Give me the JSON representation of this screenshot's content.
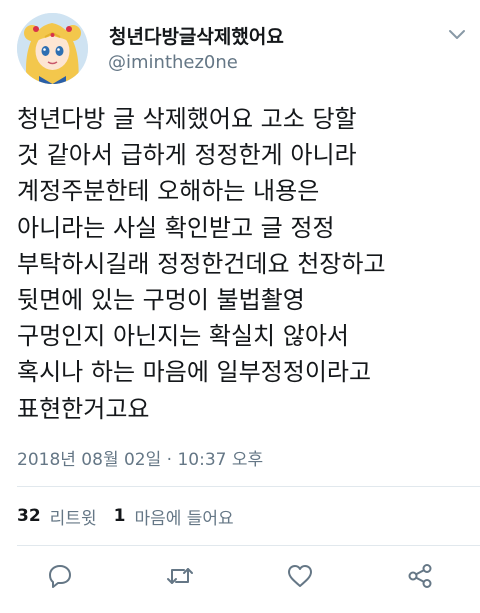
{
  "header": {
    "display_name": "청년다방글삭제했어요",
    "handle": "@iminthez0ne",
    "avatar_icon": "sailor-moon-avatar",
    "menu_icon": "chevron-down-icon"
  },
  "tweet": {
    "text": "청년다방 글 삭제했어요 고소 당할\n것 같아서 급하게 정정한게 아니라\n계정주분한테 오해하는 내용은\n아니라는 사실 확인받고 글 정정\n부탁하시길래 정정한건데요 천장하고\n뒷면에 있는 구멍이 불법촬영\n구멍인지 아닌지는 확실치 않아서\n혹시나 하는 마음에 일부정정이라고\n표현한거고요",
    "timestamp": "2018년 08월 02일 · 10:37 오후"
  },
  "stats": {
    "retweets_count": "32",
    "retweets_label": "리트윗",
    "likes_count": "1",
    "likes_label": "마음에 들어요"
  },
  "actions": [
    {
      "icon": "reply-icon"
    },
    {
      "icon": "retweet-icon"
    },
    {
      "icon": "heart-icon"
    },
    {
      "icon": "share-icon"
    }
  ],
  "colors": {
    "text": "#14171a",
    "secondary": "#657786",
    "divider": "#e1e8ed"
  }
}
